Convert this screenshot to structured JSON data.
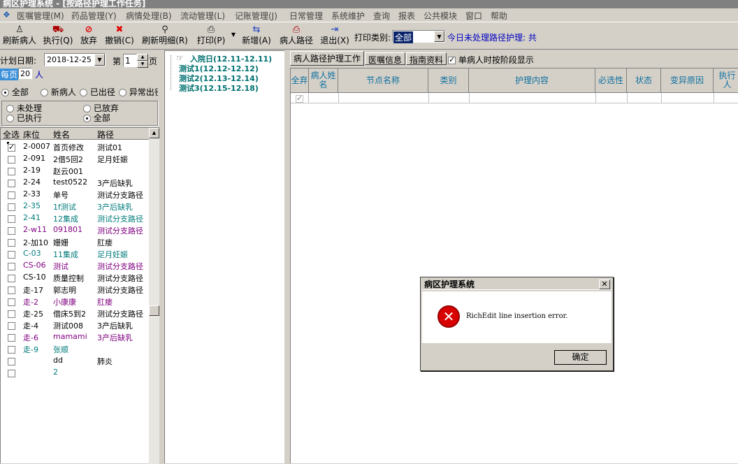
{
  "window": {
    "title": "病区护理系统 - [按路径护理工作任务]"
  },
  "menu": [
    "医嘱管理(M)",
    "药品管理(Y)",
    "病情处理(B)",
    "流动管理(L)",
    "记账管理(J)",
    "日常管理",
    "系统维护",
    "查询",
    "报表",
    "公共模块",
    "窗口",
    "帮助"
  ],
  "toolbar": {
    "buttons": [
      {
        "label": "刷新病人",
        "icon": "refresh-patient-icon",
        "glyph": "♙"
      },
      {
        "label": "执行(Q)",
        "icon": "execute-icon",
        "glyph": "⛟"
      },
      {
        "label": "放弃",
        "icon": "abandon-icon",
        "glyph": "⊘"
      },
      {
        "label": "撤销(C)",
        "icon": "cancel-icon",
        "glyph": "✖"
      },
      {
        "label": "刷新明细(R)",
        "icon": "refresh-detail-icon",
        "glyph": "⚲"
      },
      {
        "label": "打印(P)",
        "icon": "printer-icon",
        "glyph": "⎙"
      },
      {
        "label": "新增(A)",
        "icon": "add-icon",
        "glyph": "⇆"
      },
      {
        "label": "病人路径",
        "icon": "patient-path-icon",
        "glyph": "⎙"
      },
      {
        "label": "退出(X)",
        "icon": "exit-icon",
        "glyph": "⇥"
      }
    ],
    "print_category_label": "打印类别:",
    "print_category_value": "全部",
    "today_unprocessed": "今日未处理路径护理: 共"
  },
  "left": {
    "plan_date_label": "计划日期:",
    "plan_date_value": "2018-12-25",
    "page_prefix": "第",
    "page_value": "1",
    "page_suffix": "页",
    "per_page_label": "每页",
    "per_page_value": "20",
    "per_page_unit": "人",
    "filter1": [
      "全部",
      "新病人",
      "已出径",
      "异常出径"
    ],
    "filter1_selected": 0,
    "filter2": [
      "未处理",
      "已放弃",
      "已执行",
      "全部"
    ],
    "filter2_selected": 3,
    "grid_headers": [
      "全选",
      "床位",
      "姓名",
      "路径"
    ],
    "rows": [
      {
        "bed": "2-0007",
        "name": "首页修改",
        "path": "测试01",
        "color": "#000000",
        "checked": true
      },
      {
        "bed": "2-091",
        "name": "2借5回2",
        "path": "足月妊娠",
        "color": "#000000",
        "checked": false
      },
      {
        "bed": "2-19",
        "name": "赵云001",
        "path": "",
        "color": "#000000",
        "checked": false
      },
      {
        "bed": "2-24",
        "name": "test0522",
        "path": "3产后缺乳",
        "color": "#000000",
        "checked": false
      },
      {
        "bed": "2-33",
        "name": "单号",
        "path": "测试分支路径",
        "color": "#000000",
        "checked": false
      },
      {
        "bed": "2-35",
        "name": "1f测试",
        "path": "3产后缺乳",
        "color": "#007b7b",
        "checked": false
      },
      {
        "bed": "2-41",
        "name": "12集成",
        "path": "测试分支路径",
        "color": "#007b7b",
        "checked": false
      },
      {
        "bed": "2-w11",
        "name": "091801",
        "path": "测试分支路径",
        "color": "#800080",
        "checked": false
      },
      {
        "bed": "2-加10",
        "name": "姗姗",
        "path": "肛瘘",
        "color": "#000000",
        "checked": false
      },
      {
        "bed": "C-03",
        "name": "11集成",
        "path": "足月妊娠",
        "color": "#007b7b",
        "checked": false
      },
      {
        "bed": "CS-06",
        "name": "测试",
        "path": "测试分支路径",
        "color": "#800080",
        "checked": false
      },
      {
        "bed": "CS-10",
        "name": "质量控制",
        "path": "测试分支路径",
        "color": "#000000",
        "checked": false
      },
      {
        "bed": "走-17",
        "name": "郭志明",
        "path": "测试分支路径",
        "color": "#000000",
        "checked": false
      },
      {
        "bed": "走-2",
        "name": "小康康",
        "path": "肛瘘",
        "color": "#800080",
        "checked": false
      },
      {
        "bed": "走-25",
        "name": "借床5到2",
        "path": "测试分支路径",
        "color": "#000000",
        "checked": false
      },
      {
        "bed": "走-4",
        "name": "测试008",
        "path": "3产后缺乳",
        "color": "#000000",
        "checked": false
      },
      {
        "bed": "走-6",
        "name": "mamami",
        "path": "3产后缺乳",
        "color": "#800080",
        "checked": false
      },
      {
        "bed": "走-9",
        "name": "张顺",
        "path": "",
        "color": "#007b7b",
        "checked": false
      },
      {
        "bed": "",
        "name": "dd",
        "path": "肺炎",
        "color": "#000000",
        "checked": false
      },
      {
        "bed": "",
        "name": "2",
        "path": "",
        "color": "#007b7b",
        "checked": false
      }
    ]
  },
  "tree": {
    "nodes": [
      "入院日(12.11-12.11)",
      "测试1(12.12-12.12)",
      "测试2(12.13-12.14)",
      "测试3(12.15-12.18)"
    ]
  },
  "right": {
    "tabs": [
      "病人路径护理工作",
      "医嘱信息",
      "指南资料"
    ],
    "stage_display_label": "单病人时按阶段显示",
    "stage_display_checked": true,
    "headers": [
      "全弃",
      "病人姓名",
      "节点名称",
      "类别",
      "护理内容",
      "必选性",
      "状态",
      "变异原因",
      "执行人"
    ]
  },
  "dialog": {
    "title": "病区护理系统",
    "message": "RichEdit line insertion error.",
    "ok_label": "确定",
    "icon": "error-icon"
  }
}
